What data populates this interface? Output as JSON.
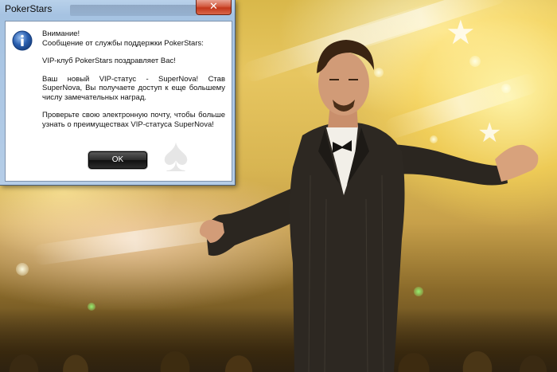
{
  "window": {
    "title": "PokerStars",
    "close_glyph": "✕"
  },
  "dialog": {
    "icon": "info-icon",
    "lines": {
      "attention": "Внимание!",
      "source": "Сообщение от службы поддержки PokerStars:",
      "congrats": "VIP-клуб PokerStars поздравляет Вас!",
      "status": "Ваш новый VIP-статус - SuperNova! Став SuperNova, Вы получаете доступ к еще большему числу замечательных наград.",
      "check": "Проверьте свою электронную почту, чтобы больше узнать о преимуществах VIP-статуса SuperNova!"
    },
    "ok_label": "OK"
  },
  "colors": {
    "dialog_frame": "#b5cde7",
    "close_button": "#c3371b",
    "ok_button": "#1a1a1a",
    "info_icon": "#2a5fb0"
  }
}
